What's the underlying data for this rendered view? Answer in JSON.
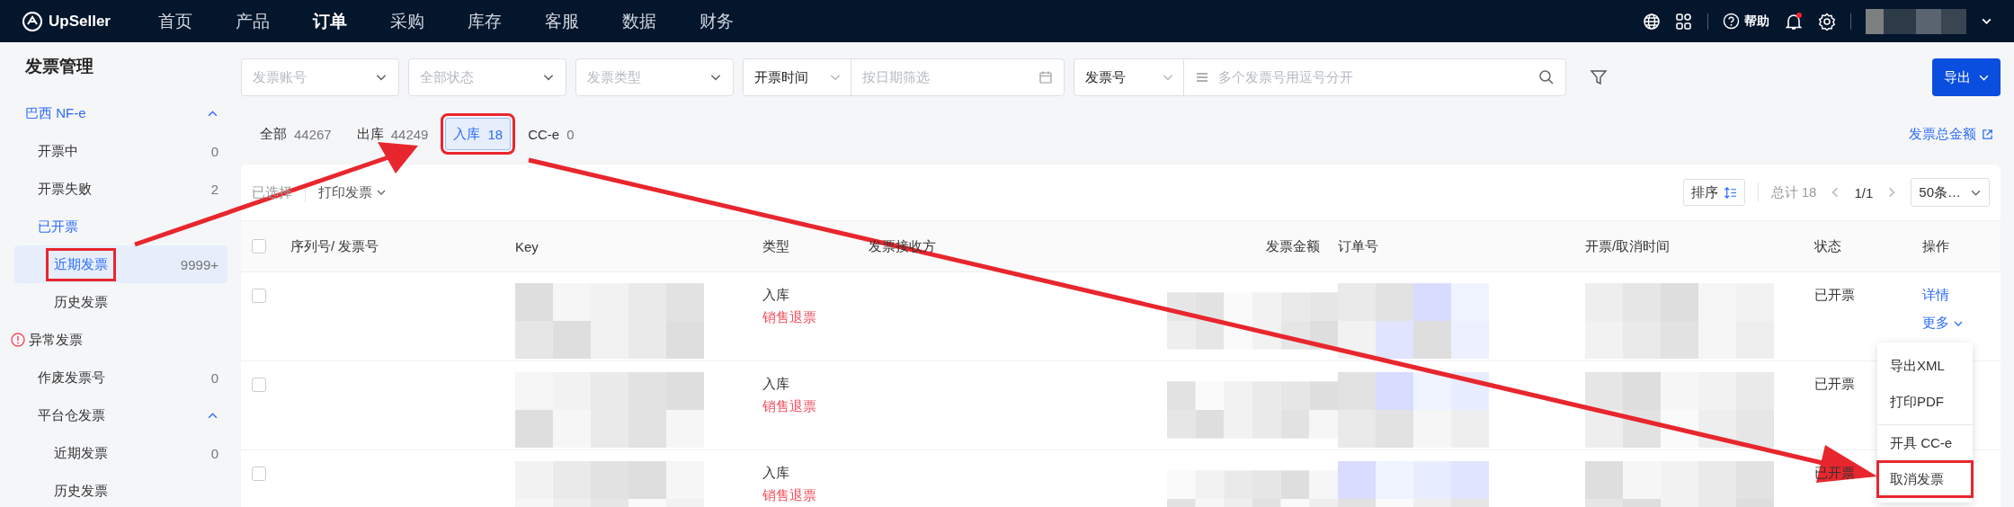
{
  "nav": {
    "brand": "UpSeller",
    "items": [
      {
        "label": "首页",
        "selected": false
      },
      {
        "label": "产品",
        "selected": false
      },
      {
        "label": "订单",
        "selected": true
      },
      {
        "label": "采购",
        "selected": false
      },
      {
        "label": "库存",
        "selected": false
      },
      {
        "label": "客服",
        "selected": false
      },
      {
        "label": "数据",
        "selected": false
      },
      {
        "label": "财务",
        "selected": false
      }
    ],
    "help": "帮助",
    "notification_dot": true
  },
  "sidebar": {
    "title": "发票管理",
    "items": [
      {
        "label": "巴西 NF-e",
        "selected": false,
        "expanded": true,
        "children": [
          {
            "label": "开票中",
            "count": "0",
            "selected": false
          },
          {
            "label": "开票失败",
            "count": "2",
            "selected": false
          },
          {
            "label": "已开票",
            "selected": false,
            "children": [
              {
                "label": "近期发票",
                "count": "9999+",
                "selected": true,
                "highlighted": true
              },
              {
                "label": "历史发票",
                "selected": false
              }
            ]
          }
        ]
      },
      {
        "label": "异常发票",
        "kind": "warning",
        "selected": false,
        "children": [
          {
            "label": "作废发票号",
            "count": "0",
            "selected": false
          },
          {
            "label": "平台仓发票",
            "selected": false,
            "expanded": true,
            "children": [
              {
                "label": "近期发票",
                "count": "0",
                "selected": false
              },
              {
                "label": "历史发票",
                "selected": false
              }
            ]
          }
        ]
      }
    ]
  },
  "filters": [
    {
      "kind": "select",
      "placeholder": "发票账号"
    },
    {
      "kind": "select",
      "placeholder": "全部状态"
    },
    {
      "kind": "select",
      "placeholder": "发票类型"
    },
    {
      "kind": "date",
      "select": "开票时间",
      "placeholder": "按日期筛选"
    },
    {
      "kind": "search",
      "select": "发票号",
      "placeholder": "多个发票号用逗号分开"
    }
  ],
  "export_button": "导出",
  "tabs": [
    {
      "label": "全部",
      "count": "44267",
      "selected": false,
      "highlighted": false
    },
    {
      "label": "出库",
      "count": "44249",
      "selected": false,
      "highlighted": false
    },
    {
      "label": "入库",
      "count": "18",
      "selected": true,
      "highlighted": true
    },
    {
      "label": "CC-e",
      "count": "0",
      "selected": false,
      "highlighted": false
    }
  ],
  "total_link": "发票总金额",
  "toolbar": {
    "selected_label": "已选择",
    "print": "打印发票",
    "sort": "排序",
    "total": "总计 18",
    "page": "1/1",
    "page_size": "50条…"
  },
  "table": {
    "select_all": {
      "checked": false
    },
    "columns": [
      "序列号/ 发票号",
      "Key",
      "类型",
      "发票接收方",
      "发票金额",
      "订单号",
      "开票/取消时间",
      "状态",
      "操作"
    ],
    "rows": [
      {
        "checked": false,
        "type": "入库",
        "subtype": "销售退票",
        "status": "已开票",
        "actions": [
          "详情",
          "更多"
        ]
      },
      {
        "checked": false,
        "type": "入库",
        "subtype": "销售退票",
        "status": "已开票"
      },
      {
        "checked": false,
        "type": "入库",
        "subtype": "销售退票",
        "status": "已开票"
      }
    ]
  },
  "row_menu": {
    "items": [
      {
        "label": "导出XML",
        "divider_before": false,
        "highlighted": false
      },
      {
        "label": "打印PDF",
        "divider_before": false,
        "highlighted": false
      },
      {
        "label": "开具 CC-e",
        "divider_before": true,
        "highlighted": false
      },
      {
        "label": "取消发票",
        "divider_before": false,
        "highlighted": true
      }
    ]
  }
}
